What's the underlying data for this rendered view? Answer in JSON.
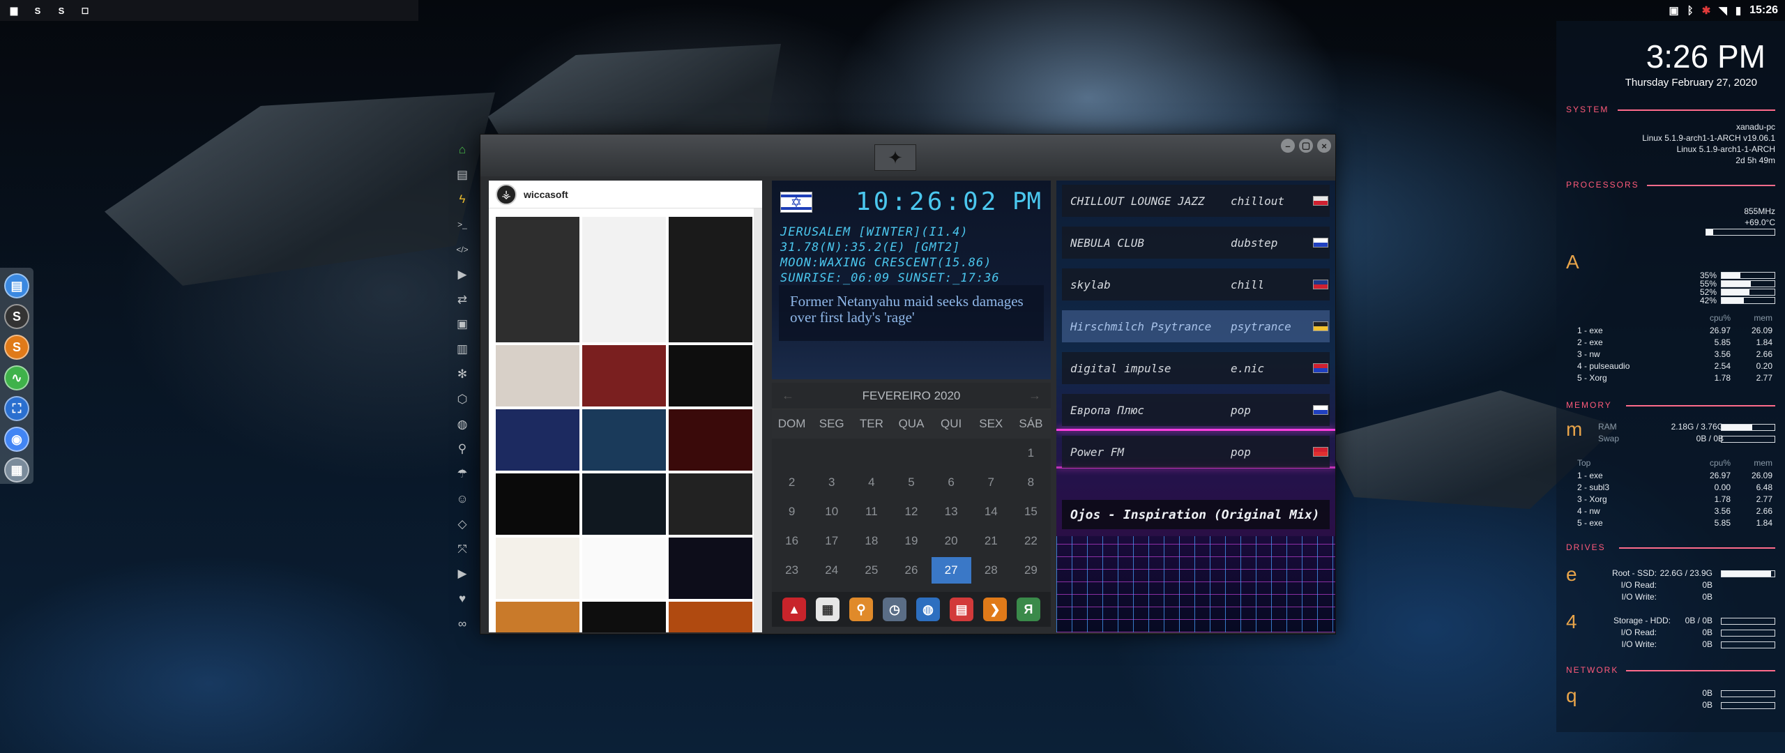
{
  "taskbar": {
    "apps": [
      {
        "icon": "file-manager-icon",
        "glyph": "▆",
        "color": "#3b86d8"
      },
      {
        "icon": "sublime-text-icon",
        "glyph": "S",
        "color": "#e58c2b"
      },
      {
        "icon": "skype-icon",
        "glyph": "S",
        "color": "#4b4b4b"
      },
      {
        "icon": "window-icon",
        "glyph": "◻",
        "color": "#555"
      }
    ],
    "tray_time": "15:26"
  },
  "dock": [
    {
      "icon": "files-icon",
      "glyph": "▤",
      "color": "#3a88e0"
    },
    {
      "icon": "skype-icon",
      "glyph": "S",
      "color": "#333"
    },
    {
      "icon": "sublime-icon",
      "glyph": "S",
      "color": "#e07a19"
    },
    {
      "icon": "activity-monitor-icon",
      "glyph": "∿",
      "color": "#3fb24a"
    },
    {
      "icon": "screenshot-icon",
      "glyph": "⛶",
      "color": "#2a6fcf"
    },
    {
      "icon": "chrome-icon",
      "glyph": "◉",
      "color": "#4285f4"
    },
    {
      "icon": "grid-icon",
      "glyph": "▦",
      "color": "#7a8b9b"
    }
  ],
  "app_strip": [
    {
      "icon": "home-icon",
      "glyph": "⌂",
      "color": "#4cc24a"
    },
    {
      "icon": "document-icon",
      "glyph": "▤"
    },
    {
      "icon": "lightning-icon",
      "glyph": "ϟ",
      "color": "#f2c230"
    },
    {
      "icon": "terminal-icon",
      "glyph": ">_"
    },
    {
      "icon": "code-icon",
      "glyph": "</>"
    },
    {
      "icon": "play-icon",
      "glyph": "▶"
    },
    {
      "icon": "translate-icon",
      "glyph": "⇄"
    },
    {
      "icon": "image-icon",
      "glyph": "▣"
    },
    {
      "icon": "news-icon",
      "glyph": "▥"
    },
    {
      "icon": "settings-icon",
      "glyph": "✻"
    },
    {
      "icon": "hexagon-icon",
      "glyph": "⬡"
    },
    {
      "icon": "globe-icon",
      "glyph": "◍"
    },
    {
      "icon": "search-icon",
      "glyph": "⚲"
    },
    {
      "icon": "umbrella-icon",
      "glyph": "☂"
    },
    {
      "icon": "contacts-icon",
      "glyph": "☺"
    },
    {
      "icon": "brackets-icon",
      "glyph": "◇"
    },
    {
      "icon": "fullscreen-icon",
      "glyph": "⤧"
    },
    {
      "icon": "youtube-icon",
      "glyph": "▶"
    },
    {
      "icon": "heart-icon",
      "glyph": "♥"
    },
    {
      "icon": "link-icon",
      "glyph": "∞"
    }
  ],
  "window": {
    "emblem": "✦"
  },
  "instagram": {
    "username": "wiccasoft",
    "tiles": [
      "#2e2e2e",
      "#f2f2f2",
      "#1a1a1a",
      "#d8d0c8",
      "#7a1f1f",
      "#0e0e0e",
      "#1c2a60",
      "#1a3a5a",
      "#3a0a0a",
      "#0a0a0a",
      "#101820",
      "#222",
      "#f4f1ea",
      "#fafafa",
      "#0d0d1a",
      "#c97a2a",
      "#0e0e0e",
      "#b04a10",
      "#8a6a3a",
      "#e8e8e8",
      "#0a0a0a"
    ]
  },
  "clock": {
    "time": "10:26:02",
    "ampm": "PM",
    "flag": "✡",
    "lines": [
      "JERUSALEM [WINTER](I1.4)",
      "31.78(N):35.2(E) [GMT2]",
      "MOON:WAXING CRESCENT(15.86)",
      "SUNRISE:_06:09 SUNSET:_17:36"
    ],
    "news": "Former Netanyahu maid seeks damages over first lady's 'rage'"
  },
  "calendar": {
    "month": "FEVEREIRO 2020",
    "days_header": [
      "DOM",
      "SEG",
      "TER",
      "QUA",
      "QUI",
      "SEX",
      "SÁB"
    ],
    "rows": [
      [
        "",
        "",
        "",
        "",
        "",
        "",
        "1"
      ],
      [
        "2",
        "3",
        "4",
        "5",
        "6",
        "7",
        "8"
      ],
      [
        "9",
        "10",
        "11",
        "12",
        "13",
        "14",
        "15"
      ],
      [
        "16",
        "17",
        "18",
        "19",
        "20",
        "21",
        "22"
      ],
      [
        "23",
        "24",
        "25",
        "26",
        "27",
        "28",
        "29"
      ]
    ],
    "today": "27",
    "dock": [
      {
        "icon": "vivaldi-icon",
        "glyph": "▲",
        "color": "#c8242b"
      },
      {
        "icon": "calendar-icon",
        "glyph": "▦",
        "color": "#e6e6e6"
      },
      {
        "icon": "search-icon",
        "glyph": "⚲",
        "color": "#e08a2a"
      },
      {
        "icon": "clock-icon",
        "glyph": "◷",
        "color": "#5a6d86"
      },
      {
        "icon": "globe-icon",
        "glyph": "◍",
        "color": "#2d6fc0"
      },
      {
        "icon": "planner-icon",
        "glyph": "▤",
        "color": "#d23a3a"
      },
      {
        "icon": "arrow-icon",
        "glyph": "❯",
        "color": "#e07a19"
      },
      {
        "icon": "yandex-icon",
        "glyph": "Я",
        "color": "#3a8a4a"
      }
    ]
  },
  "radio": {
    "stations": [
      {
        "name": "CHILLOUT LOUNGE JAZZ",
        "genre": "chillout",
        "flag_color": "#e8e8e8",
        "flag_color2": "#d02030"
      },
      {
        "name": "NEBULA CLUB",
        "genre": "dubstep",
        "flag_color": "#fff",
        "flag_color2": "#2040c0"
      },
      {
        "name": "skylab",
        "genre": "chill",
        "flag_color": "#1f3a8a",
        "flag_color2": "#d02030"
      },
      {
        "name": "Hirschmilch Psytrance",
        "genre": "psytrance",
        "flag_color": "#222",
        "flag_color2": "#f2c230"
      },
      {
        "name": "digital impulse",
        "genre": "e.nic",
        "flag_color": "#d02030",
        "flag_color2": "#2040c0"
      },
      {
        "name": "Европа Плюс",
        "genre": "pop",
        "flag_color": "#fff",
        "flag_color2": "#2040c0"
      },
      {
        "name": "Power FM",
        "genre": "pop",
        "flag_color": "#d02030",
        "flag_color2": "#e03030"
      }
    ],
    "highlighted": "Hirschmilch Psytrance",
    "now_playing": "Ojos - Inspiration (Original Mix)"
  },
  "conky": {
    "time": "3:26 PM",
    "date": "Thursday February 27, 2020",
    "system": {
      "title": "SYSTEM",
      "lines": [
        "xanadu-pc",
        "Linux 5.1.9-arch1-1-ARCH v19.06.1",
        "Linux 5.1.9-arch1-1-ARCH",
        "2d 5h 49m"
      ]
    },
    "processors": {
      "title": "PROCESSORS",
      "freq": "855MHz",
      "temp": "+69.0°C",
      "letter": "A",
      "cores": [
        {
          "label": "35%",
          "level": 0.35
        },
        {
          "label": "55%",
          "level": 0.55
        },
        {
          "label": "52%",
          "level": 0.52
        },
        {
          "label": "42%",
          "level": 0.42
        }
      ],
      "header": [
        "cpu%",
        "mem"
      ],
      "top": [
        [
          "1 - exe",
          "26.97",
          "26.09"
        ],
        [
          "2 - exe",
          "5.85",
          "1.84"
        ],
        [
          "3 - nw",
          "3.56",
          "2.66"
        ],
        [
          "4 - pulseaudio",
          "2.54",
          "0.20"
        ],
        [
          "5 - Xorg",
          "1.78",
          "2.77"
        ]
      ]
    },
    "memory": {
      "title": "MEMORY",
      "letter": "m",
      "ram_label": "RAM",
      "ram": "2.18G / 3.76G",
      "ram_level": 0.58,
      "swap_label": "Swap",
      "swap": "0B / 0B",
      "top_label": "Top",
      "header": [
        "cpu%",
        "mem"
      ],
      "top": [
        [
          "1 - exe",
          "26.97",
          "26.09"
        ],
        [
          "2 - subl3",
          "0.00",
          "6.48"
        ],
        [
          "3 - Xorg",
          "1.78",
          "2.77"
        ],
        [
          "4 - nw",
          "3.56",
          "2.66"
        ],
        [
          "5 - exe",
          "5.85",
          "1.84"
        ]
      ]
    },
    "drives": {
      "title": "DRIVES",
      "root_letter": "e",
      "root_label": "Root - SSD:",
      "root_value": "22.6G / 23.9G",
      "root_level": 0.94,
      "io_read_label": "I/O Read:",
      "io_read": "0B",
      "io_write_label": "I/O Write:",
      "io_write": "0B",
      "storage_letter": "4",
      "storage_label": "Storage - HDD:",
      "storage_value": "0B / 0B",
      "storage_read_label": "I/O Read:",
      "storage_read": "0B",
      "storage_write_label": "I/O Write:",
      "storage_write": "0B"
    },
    "network": {
      "title": "NETWORK",
      "letter": "q",
      "down": "0B",
      "up": "0B"
    }
  }
}
